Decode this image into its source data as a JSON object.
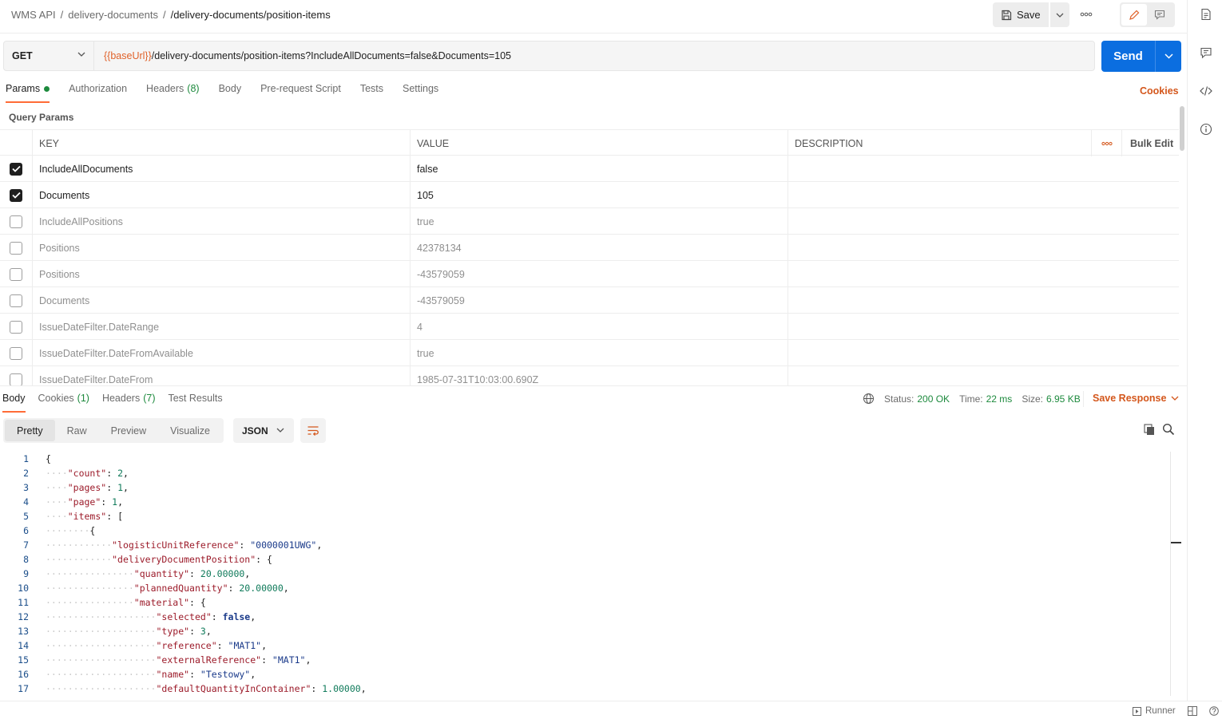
{
  "breadcrumb": {
    "items": [
      "WMS API",
      "delivery-documents"
    ],
    "separator": "/",
    "current": "/delivery-documents/position-items"
  },
  "toolbar": {
    "save_label": "Save",
    "more_label": "ooo"
  },
  "request": {
    "method": "GET",
    "url_variable": "{{baseUrl}}",
    "url_path": "/delivery-documents/position-items?IncludeAllDocuments=false&Documents=105",
    "send_label": "Send"
  },
  "request_tabs": [
    {
      "label": "Params",
      "active": true,
      "has_dot": true
    },
    {
      "label": "Authorization"
    },
    {
      "label": "Headers",
      "count": "(8)"
    },
    {
      "label": "Body"
    },
    {
      "label": "Pre-request Script"
    },
    {
      "label": "Tests"
    },
    {
      "label": "Settings"
    }
  ],
  "cookies_label": "Cookies",
  "query_params": {
    "title": "Query Params",
    "columns": {
      "key": "KEY",
      "value": "VALUE",
      "description": "DESCRIPTION",
      "bulk_edit": "Bulk Edit"
    },
    "rows": [
      {
        "checked": true,
        "key": "IncludeAllDocuments",
        "value": "false",
        "description": ""
      },
      {
        "checked": true,
        "key": "Documents",
        "value": "105",
        "description": ""
      },
      {
        "checked": false,
        "key": "IncludeAllPositions",
        "value": "true",
        "description": ""
      },
      {
        "checked": false,
        "key": "Positions",
        "value": "42378134",
        "description": ""
      },
      {
        "checked": false,
        "key": "Positions",
        "value": "-43579059",
        "description": ""
      },
      {
        "checked": false,
        "key": "Documents",
        "value": "-43579059",
        "description": ""
      },
      {
        "checked": false,
        "key": "IssueDateFilter.DateRange",
        "value": "4",
        "description": ""
      },
      {
        "checked": false,
        "key": "IssueDateFilter.DateFromAvailable",
        "value": "true",
        "description": ""
      },
      {
        "checked": false,
        "key": "IssueDateFilter.DateFrom",
        "value": "1985-07-31T10:03:00.690Z",
        "description": ""
      }
    ]
  },
  "response_tabs": [
    {
      "label": "Body",
      "active": true
    },
    {
      "label": "Cookies",
      "count": "(1)"
    },
    {
      "label": "Headers",
      "count": "(7)"
    },
    {
      "label": "Test Results"
    }
  ],
  "response_status": {
    "status_label": "Status:",
    "status": "200 OK",
    "time_label": "Time:",
    "time": "22 ms",
    "size_label": "Size:",
    "size": "6.95 KB",
    "save_response_label": "Save Response"
  },
  "view_modes": [
    {
      "label": "Pretty",
      "active": true
    },
    {
      "label": "Raw"
    },
    {
      "label": "Preview"
    },
    {
      "label": "Visualize"
    }
  ],
  "format": "JSON",
  "code_lines": [
    {
      "n": "1",
      "indent": 0,
      "text": "{"
    },
    {
      "n": "2",
      "indent": 1,
      "key": "count",
      "value": "2",
      "vtype": "n",
      "tail": ","
    },
    {
      "n": "3",
      "indent": 1,
      "key": "pages",
      "value": "1",
      "vtype": "n",
      "tail": ","
    },
    {
      "n": "4",
      "indent": 1,
      "key": "page",
      "value": "1",
      "vtype": "n",
      "tail": ","
    },
    {
      "n": "5",
      "indent": 1,
      "key": "items",
      "value": "[",
      "vtype": "p",
      "tail": ""
    },
    {
      "n": "6",
      "indent": 2,
      "text": "{"
    },
    {
      "n": "7",
      "indent": 3,
      "key": "logisticUnitReference",
      "value": "\"0000001UWG\"",
      "vtype": "s",
      "tail": ","
    },
    {
      "n": "8",
      "indent": 3,
      "key": "deliveryDocumentPosition",
      "value": "{",
      "vtype": "p",
      "tail": ""
    },
    {
      "n": "9",
      "indent": 4,
      "key": "quantity",
      "value": "20.00000",
      "vtype": "n",
      "tail": ","
    },
    {
      "n": "10",
      "indent": 4,
      "key": "plannedQuantity",
      "value": "20.00000",
      "vtype": "n",
      "tail": ","
    },
    {
      "n": "11",
      "indent": 4,
      "key": "material",
      "value": "{",
      "vtype": "p",
      "tail": ""
    },
    {
      "n": "12",
      "indent": 5,
      "key": "selected",
      "value": "false",
      "vtype": "b",
      "tail": ","
    },
    {
      "n": "13",
      "indent": 5,
      "key": "type",
      "value": "3",
      "vtype": "n",
      "tail": ","
    },
    {
      "n": "14",
      "indent": 5,
      "key": "reference",
      "value": "\"MAT1\"",
      "vtype": "s",
      "tail": ","
    },
    {
      "n": "15",
      "indent": 5,
      "key": "externalReference",
      "value": "\"MAT1\"",
      "vtype": "s",
      "tail": ","
    },
    {
      "n": "16",
      "indent": 5,
      "key": "name",
      "value": "\"Testowy\"",
      "vtype": "s",
      "tail": ","
    },
    {
      "n": "17",
      "indent": 5,
      "key": "defaultQuantityInContainer",
      "value": "1.00000",
      "vtype": "n",
      "tail": ","
    }
  ],
  "statusbar": {
    "runner_label": "Runner"
  },
  "colors": {
    "accent": "#ff6c37",
    "send": "#0b6ee0",
    "success": "#1d8a3d",
    "link": "#d4571c"
  }
}
